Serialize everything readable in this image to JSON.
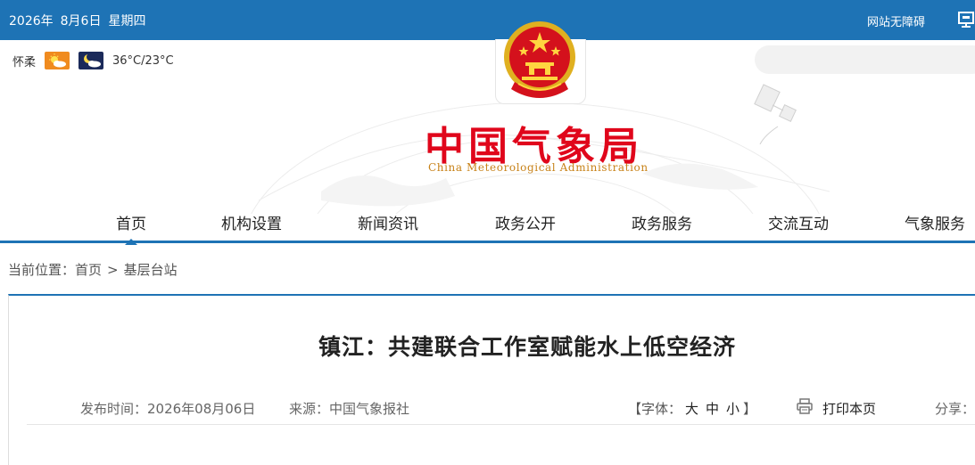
{
  "topbar": {
    "date": "2026年",
    "day": "8月6日",
    "weekday": "星期四",
    "accessible_label": "网站无障碍",
    "bg_color": "#1e73b5"
  },
  "weather": {
    "city": "怀柔",
    "day_icon": "sun-cloud-icon",
    "night_icon": "moon-cloud-icon",
    "temperature": "36°C/23°C"
  },
  "logo": {
    "cn": "中国气象局",
    "en": "China Meteorological Administration",
    "color": "#e0061b"
  },
  "nav": {
    "items": [
      "首页",
      "机构设置",
      "新闻资讯",
      "政务公开",
      "政务服务",
      "交流互动",
      "气象服务"
    ],
    "active_index": 0
  },
  "breadcrumb": {
    "prefix": "当前位置：",
    "home": "首页",
    "separator": ">",
    "current": "基层台站"
  },
  "article": {
    "title": "镇江：共建联合工作室赋能水上低空经济",
    "publish": "发布时间：2026年08月06日",
    "source": "来源：中国气象报社",
    "font_prefix": "【字体：",
    "font_large": "大",
    "font_medium": "中",
    "font_small": "小",
    "font_suffix": "】",
    "print_label": "打印本页",
    "share_label": "分享："
  }
}
